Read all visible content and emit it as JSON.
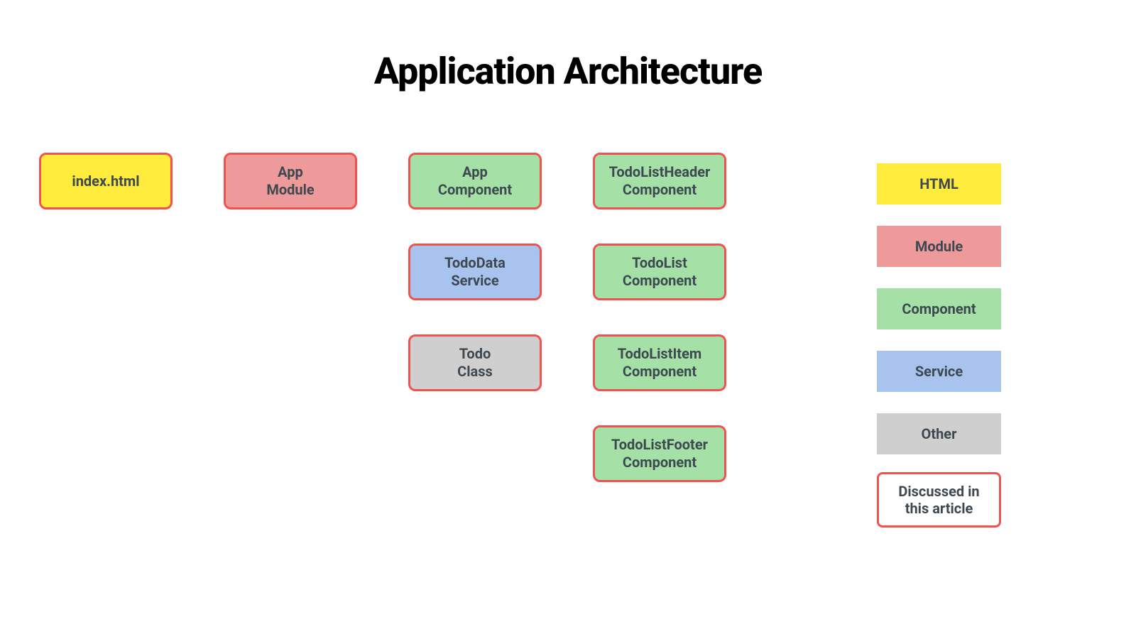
{
  "title": "Application Architecture",
  "colors": {
    "html": "#ffeb3b",
    "module": "#ef9a9a",
    "component": "#a5e1a6",
    "service": "#a8c4ee",
    "other": "#cfcfcf",
    "outline": "#ef5350"
  },
  "boxes": {
    "index_html": "index.html",
    "app_module": "App\nModule",
    "app_component": "App\nComponent",
    "tododata_service": "TodoData\nService",
    "todo_class": "Todo\nClass",
    "todolistheader_component": "TodoListHeader\nComponent",
    "todolist_component": "TodoList\nComponent",
    "todolistitem_component": "TodoListItem\nComponent",
    "todolistfooter_component": "TodoListFooter\nComponent"
  },
  "legend": {
    "html": "HTML",
    "module": "Module",
    "component": "Component",
    "service": "Service",
    "other": "Other",
    "discussed": "Discussed in\nthis article"
  }
}
